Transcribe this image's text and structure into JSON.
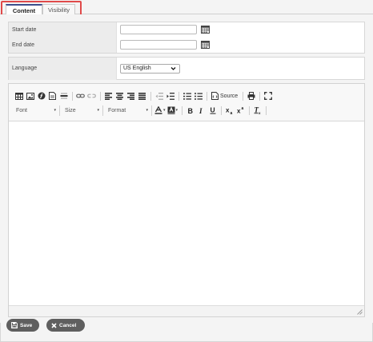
{
  "tabs": [
    {
      "label": "Content",
      "active": true
    },
    {
      "label": "Visibility",
      "active": false
    }
  ],
  "dates": {
    "start_label": "Start date",
    "start_value": "",
    "end_label": "End date",
    "end_value": ""
  },
  "language": {
    "label": "Language",
    "selected": "US English"
  },
  "toolbar": {
    "source_label": "Source",
    "font_label": "Font",
    "size_label": "Size",
    "format_label": "Format",
    "dropdown_arrow": "▾",
    "icons_row1": [
      "table-icon",
      "image-icon",
      "flash-icon",
      "page-icon",
      "horizontal-rule-icon",
      "link-icon",
      "unlink-icon",
      "align-left-icon",
      "align-center-icon",
      "align-right-icon",
      "justify-icon",
      "outdent-icon",
      "indent-icon",
      "numbered-list-icon",
      "bulleted-list-icon",
      "source-icon",
      "print-icon",
      "maximize-icon"
    ],
    "icons_row2": [
      "text-color-icon",
      "background-color-icon",
      "bold-icon",
      "italic-icon",
      "underline-icon",
      "subscript-icon",
      "superscript-icon",
      "remove-format-icon"
    ]
  },
  "footer": {
    "save_label": "Save",
    "cancel_label": "Cancel"
  },
  "colors": {
    "tab_highlight": "#e04a4a",
    "tab_active_accent": "#3d4e8c",
    "button_bg": "#5f5f5f"
  }
}
